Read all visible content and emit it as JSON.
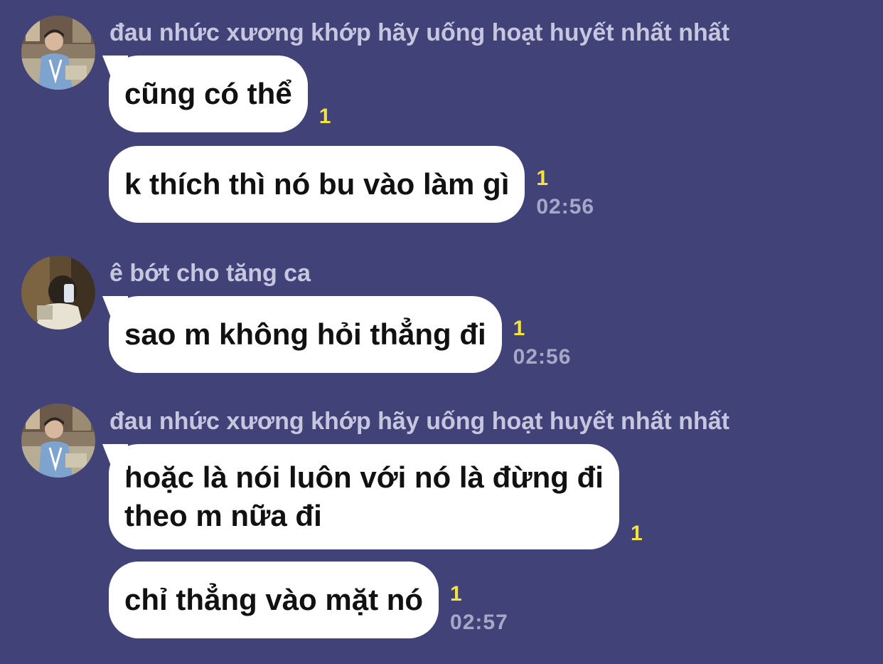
{
  "colors": {
    "background": "#414378",
    "bubble": "#ffffff",
    "read_count": "#f4e241",
    "timestamp": "#a6a8c8",
    "sender_name": "#c6c7df"
  },
  "groups": [
    {
      "sender": "đau nhức xương khớp hãy uống hoạt huyết nhất nhất",
      "avatar": "profile-photo-man-in-cafe",
      "messages": [
        {
          "text": "cũng có thể",
          "read": "1",
          "time": ""
        },
        {
          "text": "k thích thì nó bu vào làm gì",
          "read": "1",
          "time": "02:56"
        }
      ]
    },
    {
      "sender": "ê bớt cho tăng ca",
      "avatar": "profile-photo-mirror-selfie",
      "messages": [
        {
          "text": "sao m không hỏi thẳng đi",
          "read": "1",
          "time": "02:56"
        }
      ]
    },
    {
      "sender": "đau nhức xương khớp hãy uống hoạt huyết nhất nhất",
      "avatar": "profile-photo-man-in-cafe",
      "messages": [
        {
          "lines": [
            "hoặc là nói luôn với nó là đừng đi",
            "theo m nữa đi"
          ],
          "read": "1",
          "time": ""
        },
        {
          "text": "chỉ thẳng vào mặt nó",
          "read": "1",
          "time": "02:57"
        }
      ]
    }
  ]
}
